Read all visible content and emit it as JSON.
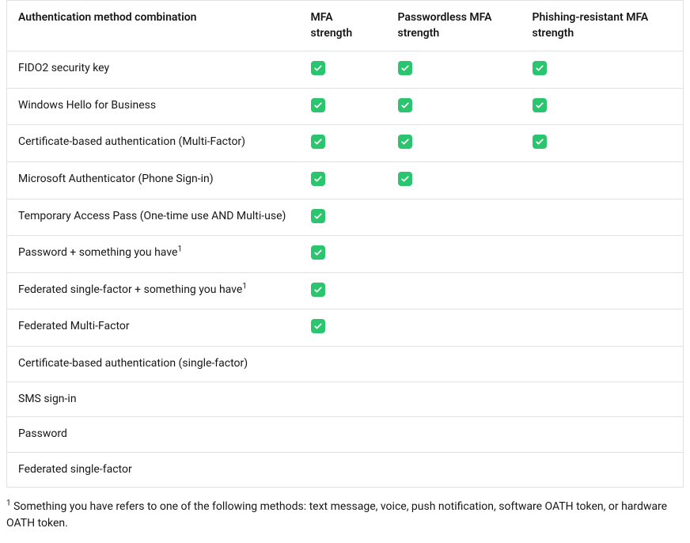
{
  "table": {
    "headers": {
      "method": "Authentication method combination",
      "mfa": "MFA strength",
      "passwordless": "Passwordless MFA strength",
      "phishing_resistant": "Phishing-resistant MFA strength"
    },
    "rows": [
      {
        "method": "FIDO2 security key",
        "footnote_ref": "",
        "mfa": true,
        "passwordless": true,
        "phishing_resistant": true
      },
      {
        "method": "Windows Hello for Business",
        "footnote_ref": "",
        "mfa": true,
        "passwordless": true,
        "phishing_resistant": true
      },
      {
        "method": "Certificate-based authentication (Multi-Factor)",
        "footnote_ref": "",
        "mfa": true,
        "passwordless": true,
        "phishing_resistant": true
      },
      {
        "method": "Microsoft Authenticator (Phone Sign-in)",
        "footnote_ref": "",
        "mfa": true,
        "passwordless": true,
        "phishing_resistant": false
      },
      {
        "method": "Temporary Access Pass (One-time use AND Multi-use)",
        "footnote_ref": "",
        "mfa": true,
        "passwordless": false,
        "phishing_resistant": false
      },
      {
        "method": "Password + something you have",
        "footnote_ref": "1",
        "mfa": true,
        "passwordless": false,
        "phishing_resistant": false
      },
      {
        "method": "Federated single-factor + something you have",
        "footnote_ref": "1",
        "mfa": true,
        "passwordless": false,
        "phishing_resistant": false
      },
      {
        "method": "Federated Multi-Factor",
        "footnote_ref": "",
        "mfa": true,
        "passwordless": false,
        "phishing_resistant": false
      },
      {
        "method": "Certificate-based authentication (single-factor)",
        "footnote_ref": "",
        "mfa": false,
        "passwordless": false,
        "phishing_resistant": false
      },
      {
        "method": "SMS sign-in",
        "footnote_ref": "",
        "mfa": false,
        "passwordless": false,
        "phishing_resistant": false
      },
      {
        "method": "Password",
        "footnote_ref": "",
        "mfa": false,
        "passwordless": false,
        "phishing_resistant": false
      },
      {
        "method": "Federated single-factor",
        "footnote_ref": "",
        "mfa": false,
        "passwordless": false,
        "phishing_resistant": false
      }
    ]
  },
  "footnote": {
    "marker": "1",
    "text": " Something you have refers to one of the following methods: text message, voice, push notification, software OATH token, or hardware OATH token."
  },
  "icons": {
    "check": "check-icon"
  }
}
